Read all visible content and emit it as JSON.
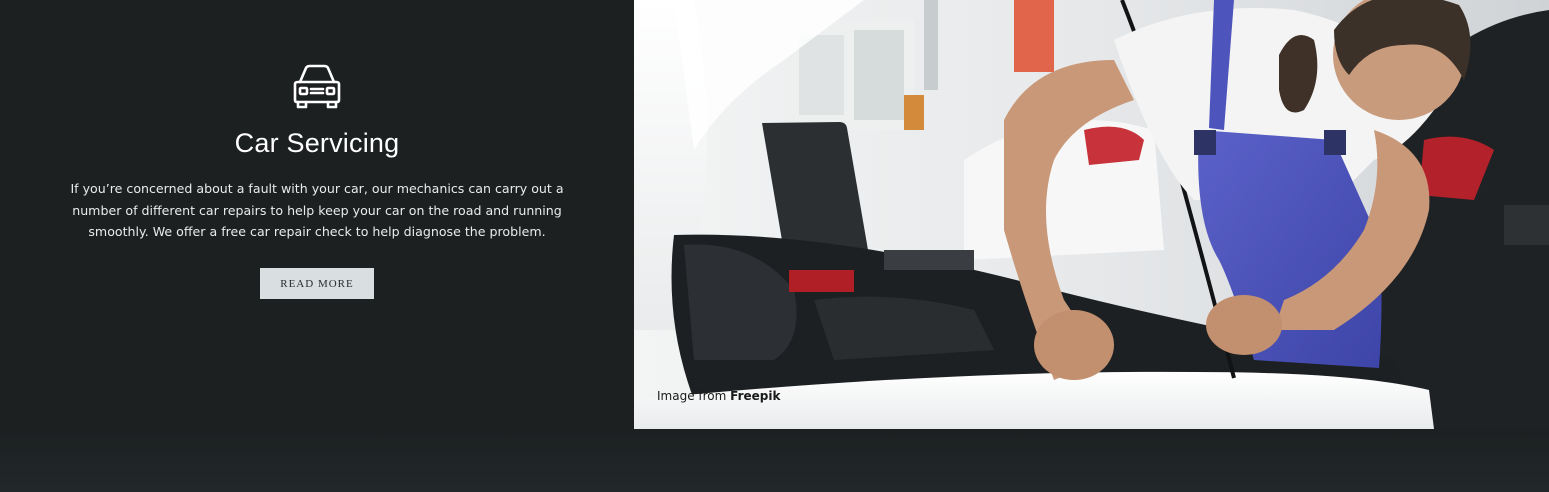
{
  "service": {
    "icon": "car-icon",
    "title": "Car Servicing",
    "description": "If you’re concerned about a fault with your car, our mechanics can carry out a number of different car repairs to help keep your car on the road and running smoothly. We offer a free car repair check to help diagnose the problem.",
    "button_label": "READ MORE"
  },
  "photo": {
    "credit_prefix": "Image from",
    "credit_source": "Freepik"
  },
  "colors": {
    "panel_background": "#1c2021",
    "button_background": "#d9dee0",
    "title_text": "#ffffff"
  }
}
